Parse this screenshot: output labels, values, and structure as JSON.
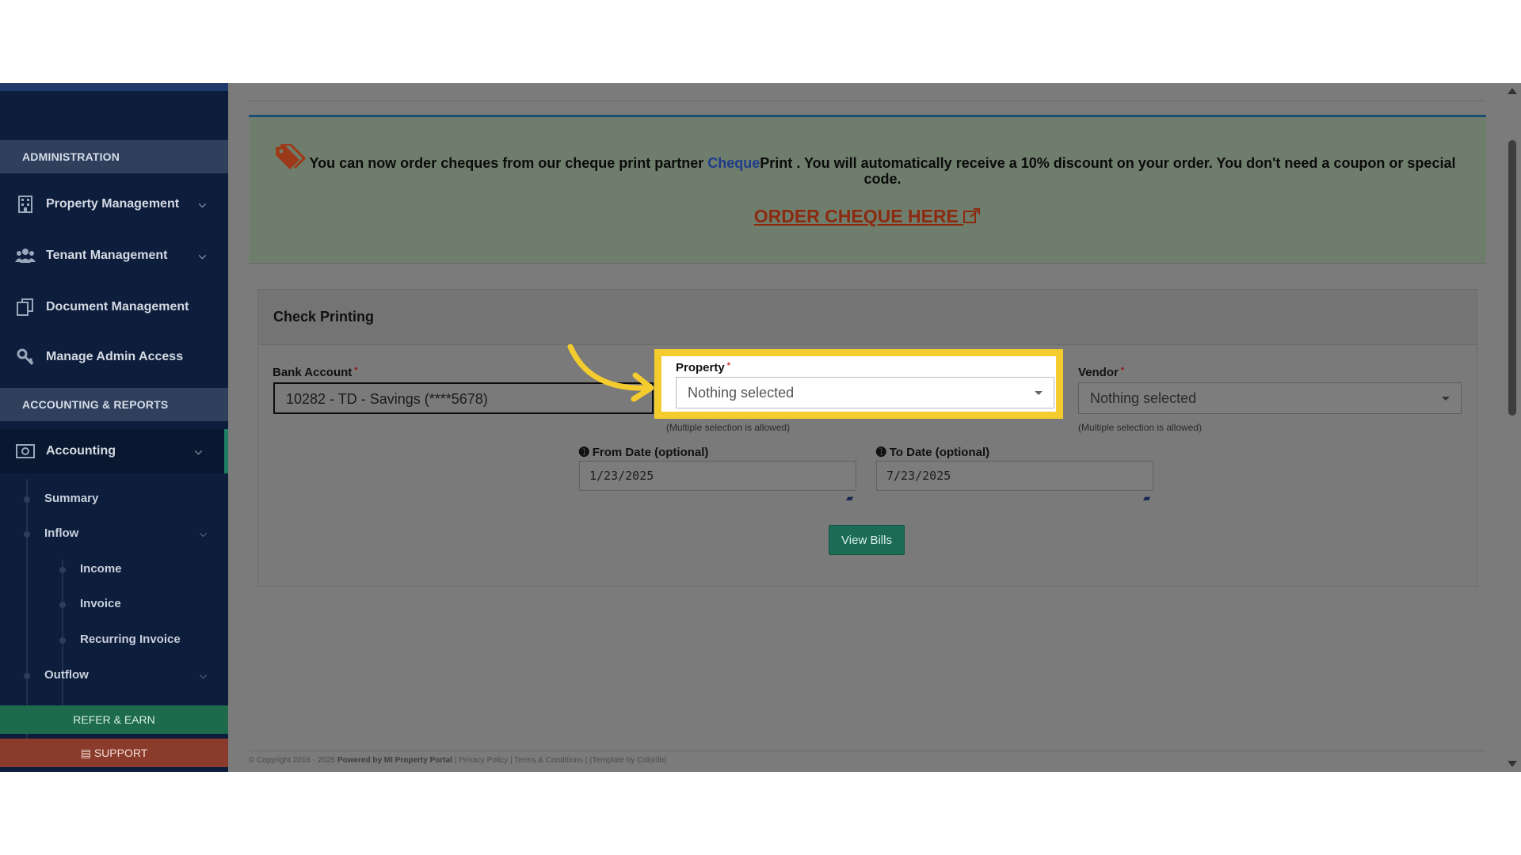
{
  "sidebar": {
    "admin_header": "ADMINISTRATION",
    "admin_items": [
      {
        "label": "Property Management",
        "icon": "building-icon"
      },
      {
        "label": "Tenant Management",
        "icon": "users-icon"
      },
      {
        "label": "Document Management",
        "icon": "documents-icon"
      },
      {
        "label": "Manage Admin Access",
        "icon": "key-icon"
      }
    ],
    "accounting_header": "ACCOUNTING & REPORTS",
    "accounting_item": {
      "label": "Accounting",
      "icon": "money-icon"
    },
    "sub_items": {
      "summary": "Summary",
      "inflow": "Inflow",
      "income": "Income",
      "invoice": "Invoice",
      "recurring_invoice": "Recurring Invoice",
      "outflow": "Outflow"
    },
    "refer_label": "REFER & EARN",
    "support_label": "SUPPORT"
  },
  "banner": {
    "message_before": "You can now order cheques from our cheque print partner",
    "brand_part1": "Cheque",
    "brand_part2": "Print",
    "message_after": ". You will automatically receive a 10% discount on your order. You don't need a coupon or special code.",
    "order_link": "ORDER CHEQUE HERE"
  },
  "check_printing": {
    "title": "Check Printing",
    "bank_account": {
      "label": "Bank Account",
      "required": "*",
      "value": "10282 - TD - Savings (****5678)"
    },
    "property": {
      "label": "Property",
      "required": "*",
      "value": "Nothing selected",
      "hint": "(Multiple selection is allowed)"
    },
    "vendor": {
      "label": "Vendor",
      "required": "*",
      "value": "Nothing selected",
      "hint": "(Multiple selection is allowed)"
    },
    "from_date": {
      "label": "From Date (optional)",
      "value": "1/23/2025"
    },
    "to_date": {
      "label": "To Date (optional)",
      "value": "7/23/2025"
    },
    "view_bills": "View Bills"
  },
  "footer": {
    "copyright": "© Copyright 2016 - 2025",
    "powered": "Powered by MI Property Portal",
    "privacy": "Privacy Policy",
    "terms": "Terms & Conditions",
    "template": "(Template by Colorlib)"
  },
  "colors": {
    "highlight": "#f5cc2e",
    "sidebar_bg": "#0d1d3c",
    "accent_green": "#1b6b55",
    "order_link": "#8c2a10"
  }
}
